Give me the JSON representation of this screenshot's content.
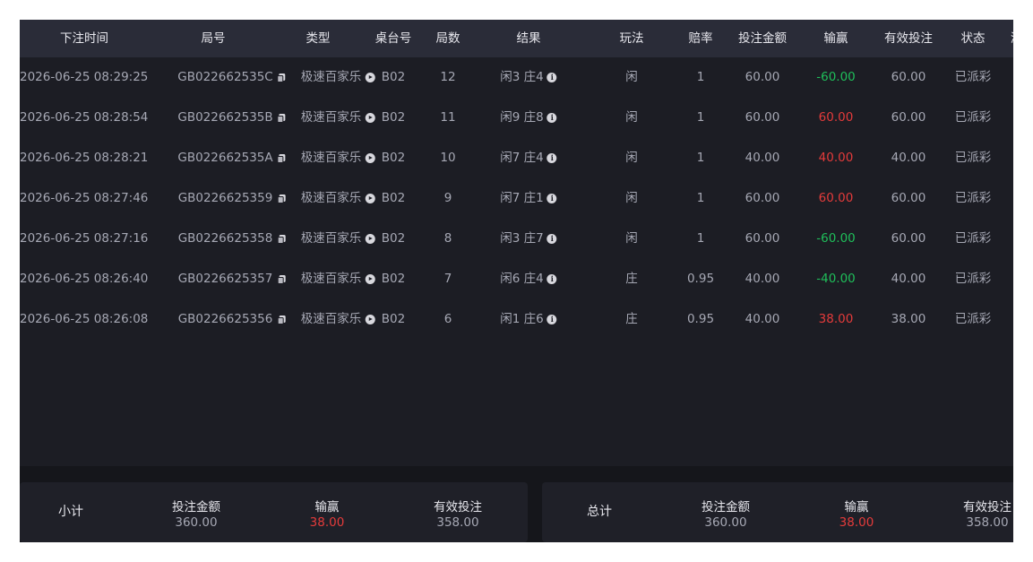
{
  "table": {
    "headers": {
      "time": "下注时间",
      "round_no": "局号",
      "type": "类型",
      "table_no": "桌台号",
      "round_count": "局数",
      "result": "结果",
      "play": "玩法",
      "odds": "赔率",
      "bet_amount": "投注金额",
      "win_loss": "输赢",
      "valid_bet": "有效投注",
      "status": "状态",
      "game_cut": "游"
    },
    "rows": [
      {
        "time": "2026-06-25 08:29:25",
        "round_no": "GB022662535C",
        "type": "极速百家乐",
        "table_no": "B02",
        "round_count": "12",
        "result": "闲3 庄4",
        "play": "闲",
        "odds": "1",
        "bet_amount": "60.00",
        "win_loss": "-60.00",
        "win_loss_color": "green",
        "valid_bet": "60.00",
        "status": "已派彩"
      },
      {
        "time": "2026-06-25 08:28:54",
        "round_no": "GB022662535B",
        "type": "极速百家乐",
        "table_no": "B02",
        "round_count": "11",
        "result": "闲9 庄8",
        "play": "闲",
        "odds": "1",
        "bet_amount": "60.00",
        "win_loss": "60.00",
        "win_loss_color": "red",
        "valid_bet": "60.00",
        "status": "已派彩"
      },
      {
        "time": "2026-06-25 08:28:21",
        "round_no": "GB022662535A",
        "type": "极速百家乐",
        "table_no": "B02",
        "round_count": "10",
        "result": "闲7 庄4",
        "play": "闲",
        "odds": "1",
        "bet_amount": "40.00",
        "win_loss": "40.00",
        "win_loss_color": "red",
        "valid_bet": "40.00",
        "status": "已派彩"
      },
      {
        "time": "2026-06-25 08:27:46",
        "round_no": "GB0226625359",
        "type": "极速百家乐",
        "table_no": "B02",
        "round_count": "9",
        "result": "闲7 庄1",
        "play": "闲",
        "odds": "1",
        "bet_amount": "60.00",
        "win_loss": "60.00",
        "win_loss_color": "red",
        "valid_bet": "60.00",
        "status": "已派彩"
      },
      {
        "time": "2026-06-25 08:27:16",
        "round_no": "GB0226625358",
        "type": "极速百家乐",
        "table_no": "B02",
        "round_count": "8",
        "result": "闲3 庄7",
        "play": "闲",
        "odds": "1",
        "bet_amount": "60.00",
        "win_loss": "-60.00",
        "win_loss_color": "green",
        "valid_bet": "60.00",
        "status": "已派彩"
      },
      {
        "time": "2026-06-25 08:26:40",
        "round_no": "GB0226625357",
        "type": "极速百家乐",
        "table_no": "B02",
        "round_count": "7",
        "result": "闲6 庄4",
        "play": "庄",
        "odds": "0.95",
        "bet_amount": "40.00",
        "win_loss": "-40.00",
        "win_loss_color": "green",
        "valid_bet": "40.00",
        "status": "已派彩"
      },
      {
        "time": "2026-06-25 08:26:08",
        "round_no": "GB0226625356",
        "type": "极速百家乐",
        "table_no": "B02",
        "round_count": "6",
        "result": "闲1 庄6",
        "play": "庄",
        "odds": "0.95",
        "bet_amount": "40.00",
        "win_loss": "38.00",
        "win_loss_color": "red",
        "valid_bet": "38.00",
        "status": "已派彩"
      }
    ]
  },
  "subtotal": {
    "title": "小计",
    "bet_label": "投注金额",
    "bet_value": "360.00",
    "win_label": "输赢",
    "win_value": "38.00",
    "valid_label": "有效投注",
    "valid_value": "358.00"
  },
  "total": {
    "title": "总计",
    "bet_label": "投注金额",
    "bet_value": "360.00",
    "win_label": "输赢",
    "win_value": "38.00",
    "valid_label": "有效投注",
    "valid_value": "358.00"
  },
  "colors": {
    "positive": "#e43b3b",
    "negative": "#1fbf5a",
    "header_bg": "#2a2c38",
    "panel_bg": "#1c1d24"
  },
  "icons": {
    "round_no": "copy-icon",
    "type": "play-icon",
    "result": "info-icon"
  }
}
